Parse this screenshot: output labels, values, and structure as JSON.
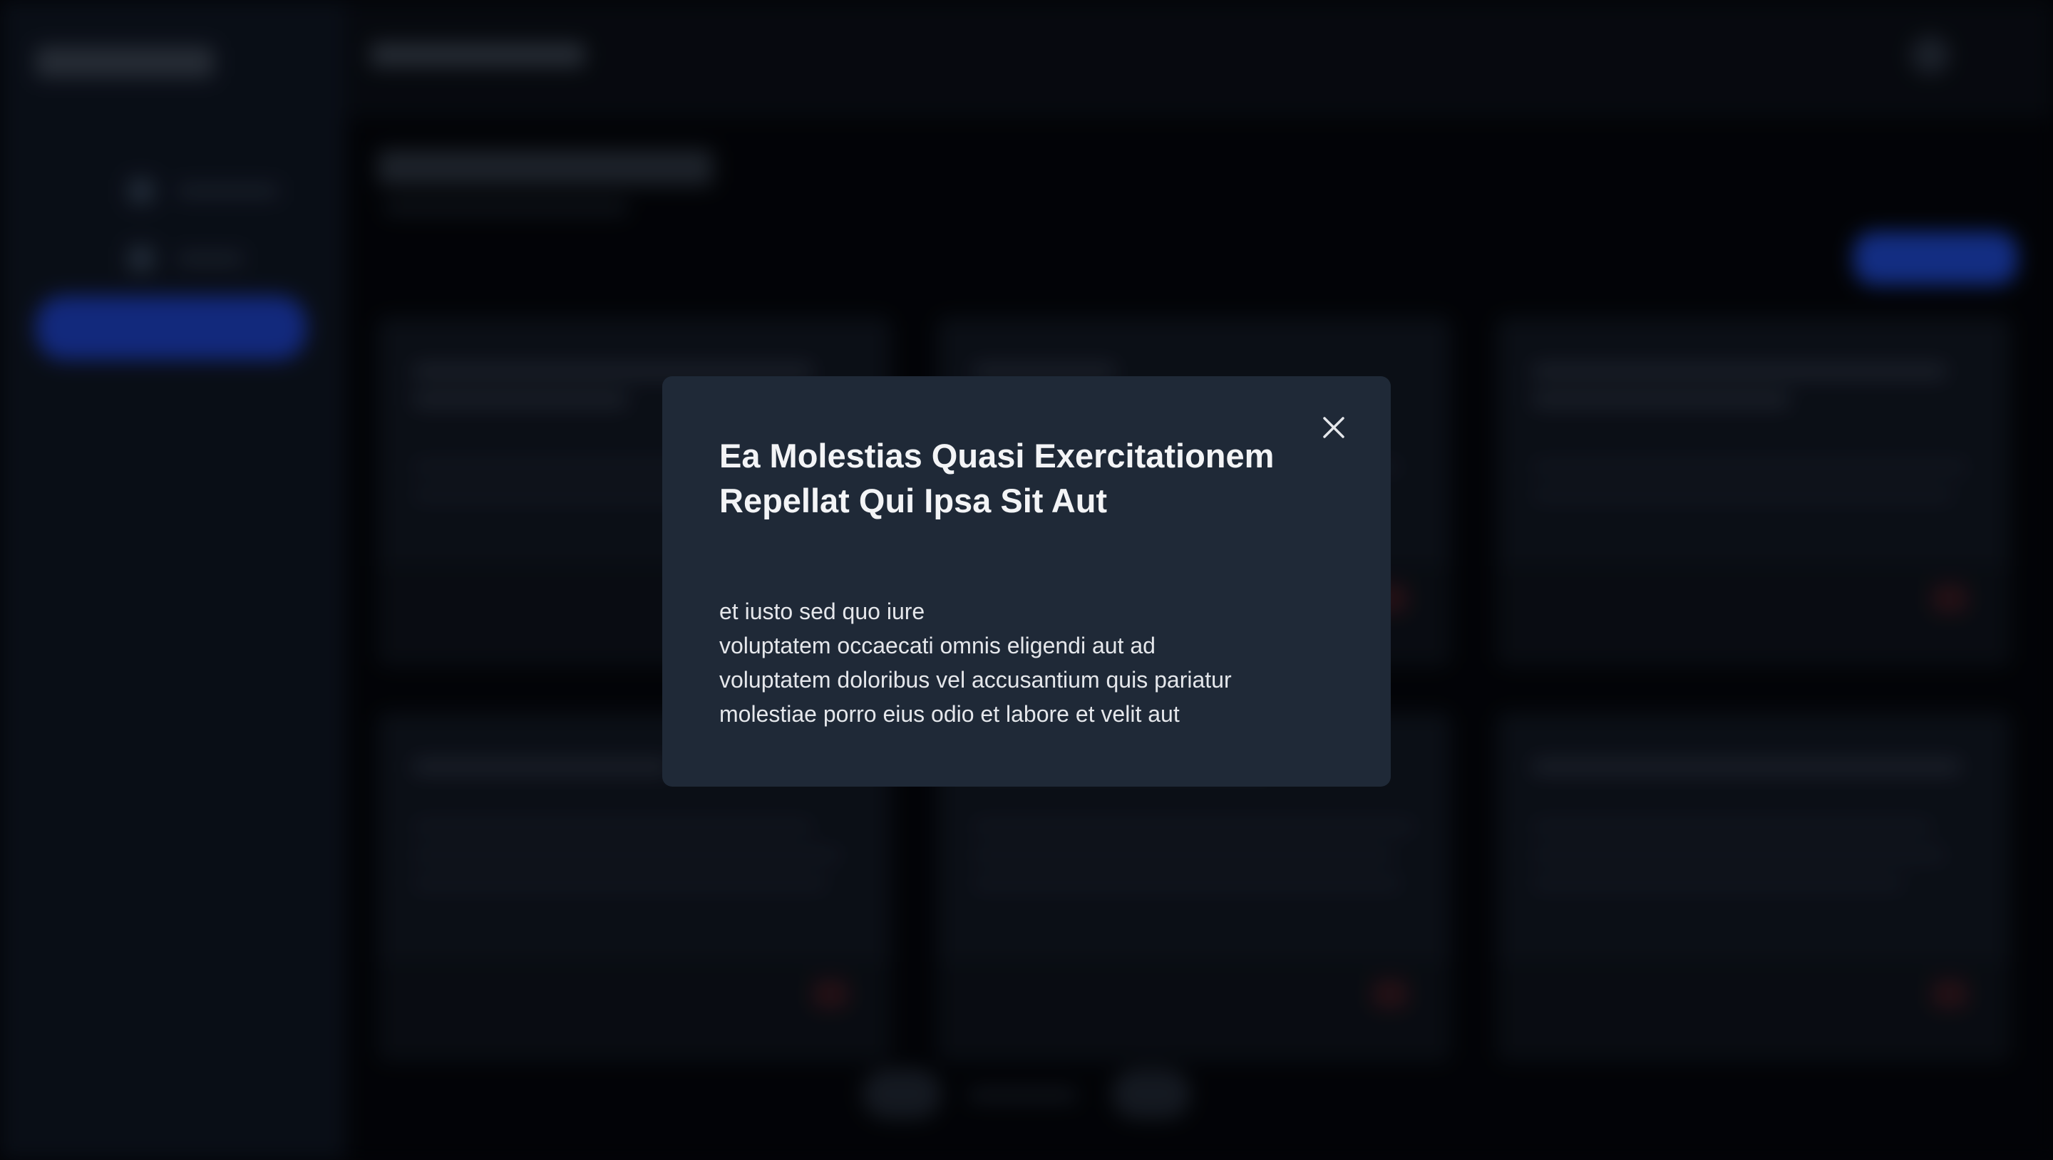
{
  "modal": {
    "title": "Ea Molestias Quasi Exercitationem Repellat Qui Ipsa Sit Aut",
    "body_lines": [
      "et iusto sed quo iure",
      "voluptatem occaecati omnis eligendi aut ad",
      "voluptatem doloribus vel accusantium quis pariatur",
      "molestiae porro eius odio et labore et velit aut"
    ],
    "close_icon": "close-icon"
  },
  "colors": {
    "modal_background": "#1f2937",
    "page_background": "#05070c",
    "sidebar_background": "#0f1623",
    "accent": "#1e46c8"
  }
}
